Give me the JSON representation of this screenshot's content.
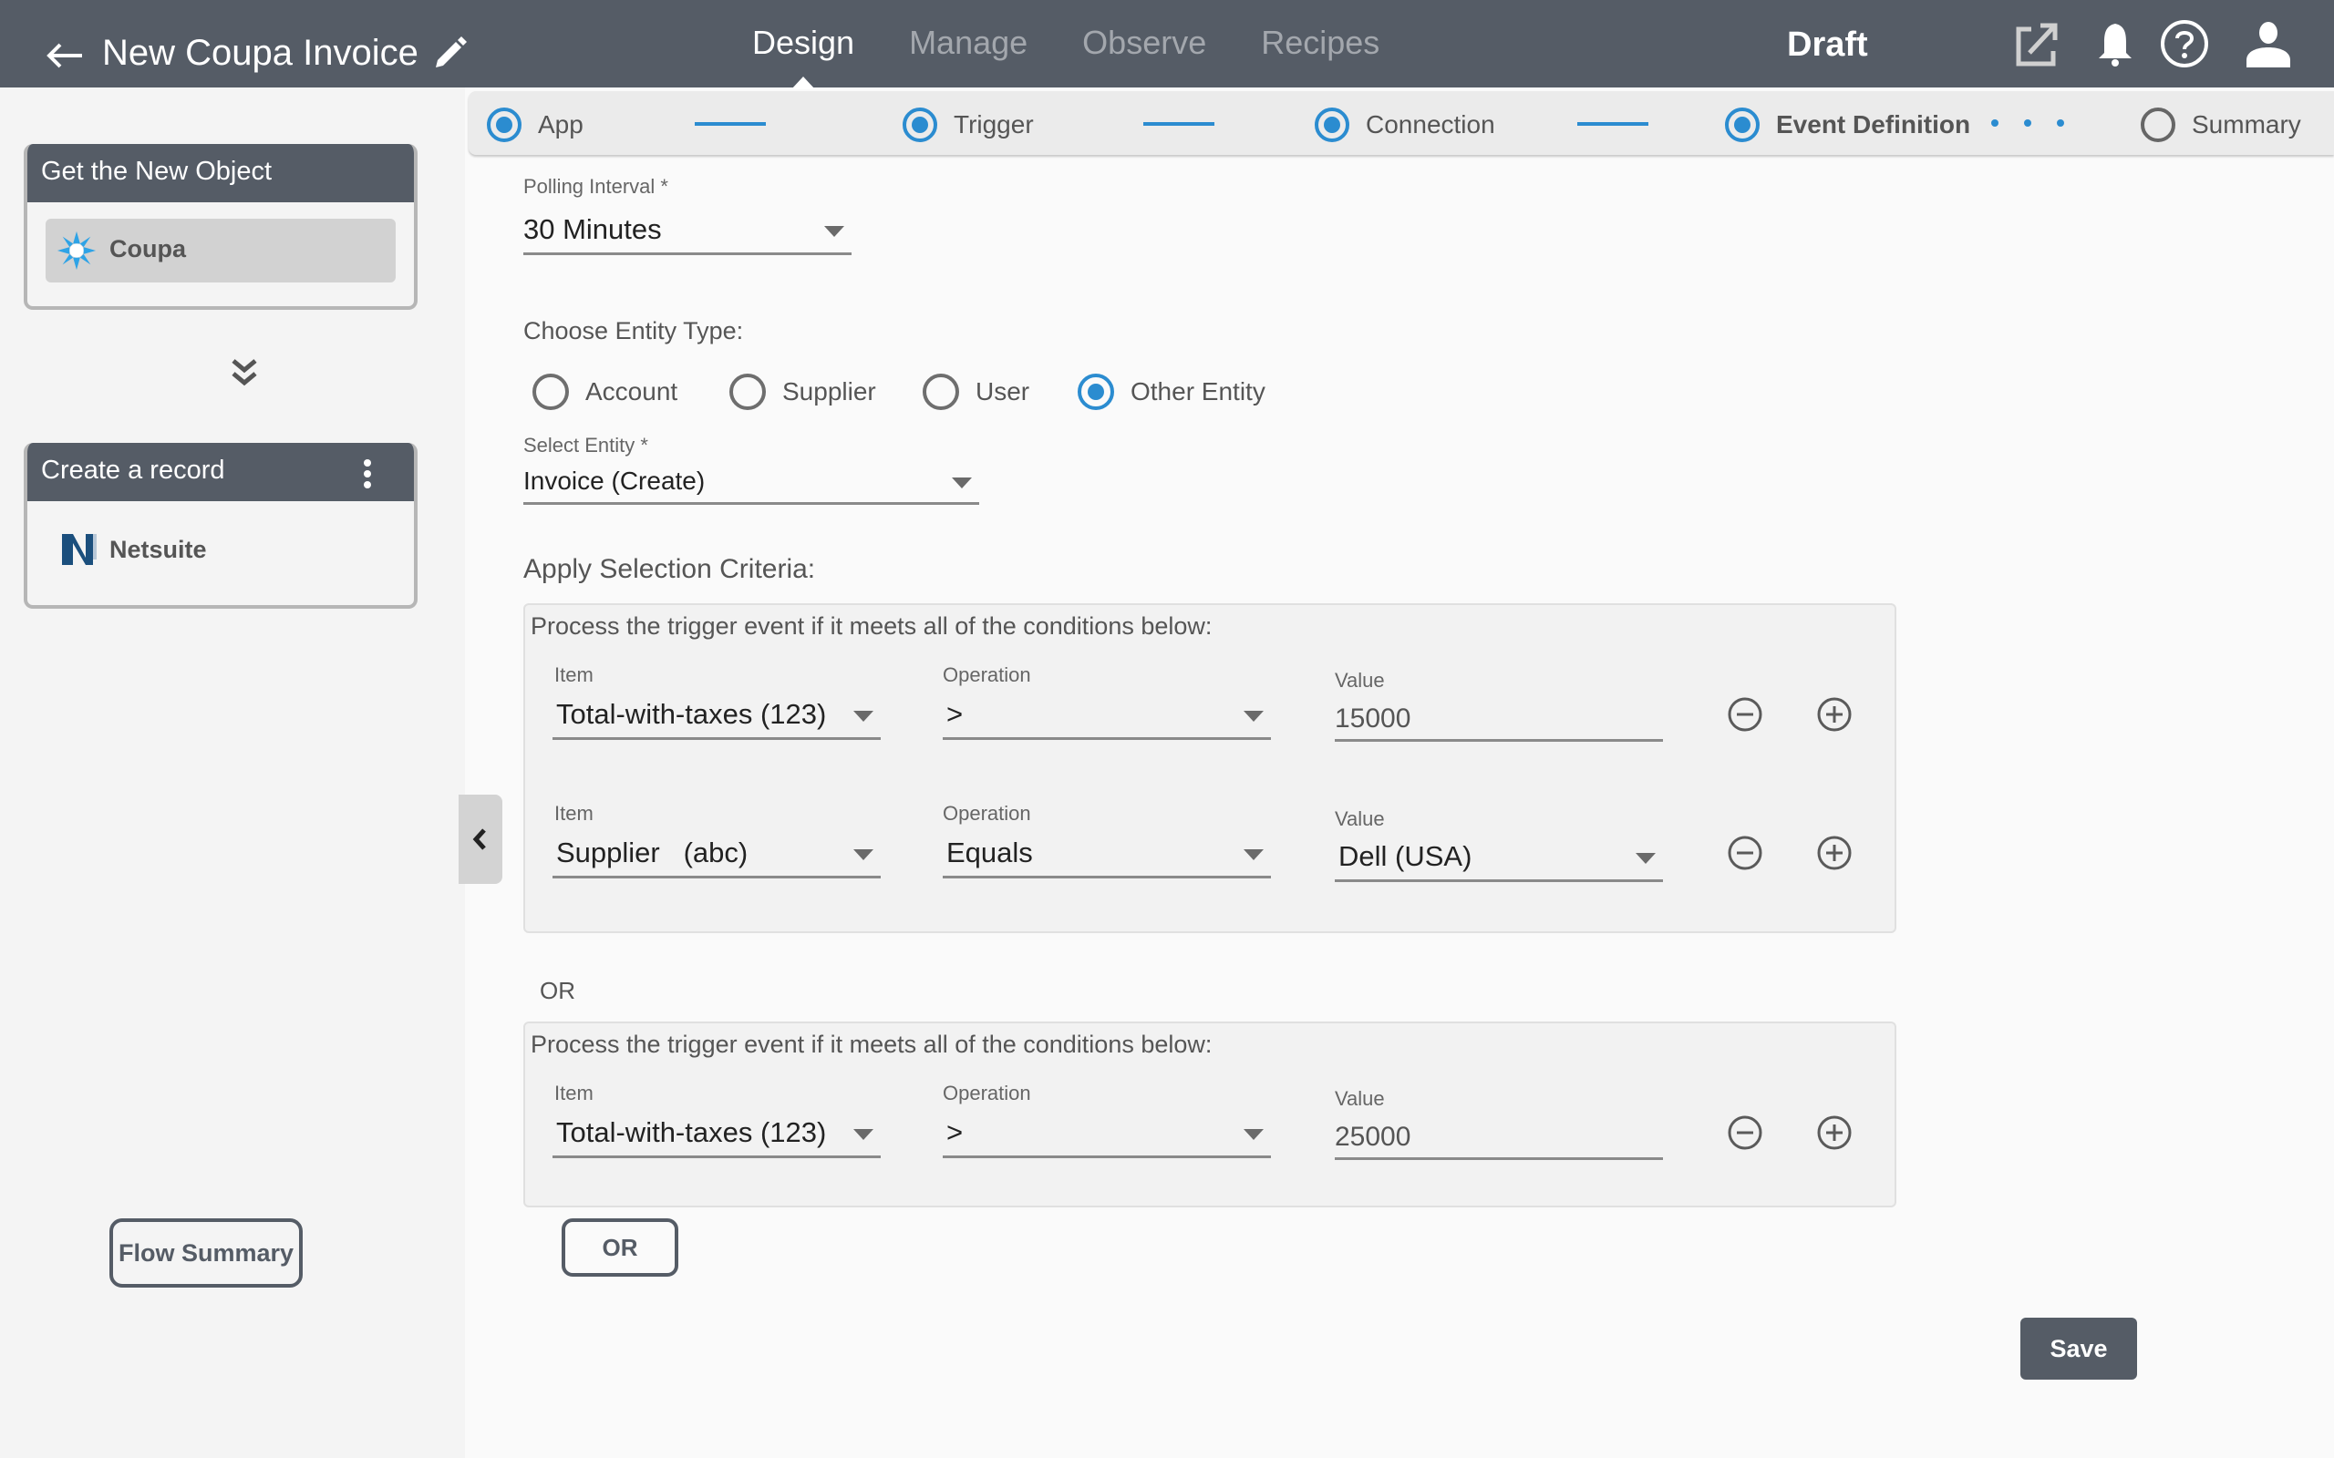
{
  "header": {
    "back_icon": "arrow-left-icon",
    "title": "New Coupa Invoice",
    "edit_icon": "pencil-icon",
    "tabs": [
      {
        "label": "Design",
        "active": true
      },
      {
        "label": "Manage",
        "active": false
      },
      {
        "label": "Observe",
        "active": false
      },
      {
        "label": "Recipes",
        "active": false
      }
    ],
    "status": "Draft",
    "icons": [
      "external-link-icon",
      "bell-icon",
      "help-icon",
      "user-icon"
    ]
  },
  "sidebar": {
    "cards": [
      {
        "title": "Get the New Object",
        "connector": "Coupa",
        "connector_icon": "coupa-logo-icon"
      },
      {
        "title": "Create a record",
        "connector": "Netsuite",
        "connector_icon": "netsuite-logo-icon",
        "menu_icon": "more-vertical-icon"
      }
    ],
    "separator_icon": "double-chevron-down-icon",
    "flow_summary_label": "Flow Summary",
    "collapse_icon": "chevron-left-icon"
  },
  "stepper": {
    "steps": [
      {
        "label": "App",
        "state": "done"
      },
      {
        "label": "Trigger",
        "state": "done"
      },
      {
        "label": "Connection",
        "state": "done"
      },
      {
        "label": "Event Definition",
        "state": "current"
      },
      {
        "label": "Summary",
        "state": "pending"
      }
    ]
  },
  "form": {
    "polling_interval": {
      "label": "Polling Interval *",
      "value": "30 Minutes"
    },
    "entity_type": {
      "label": "Choose Entity Type:",
      "options": [
        "Account",
        "Supplier",
        "User",
        "Other Entity"
      ],
      "selected": "Other Entity"
    },
    "select_entity": {
      "label": "Select Entity *",
      "value": "Invoice (Create)"
    },
    "criteria_label": "Apply Selection Criteria:",
    "groups": [
      {
        "title": "Process the trigger event if it meets all of the conditions below:",
        "conditions": [
          {
            "item_label": "Item",
            "item": "Total-with-taxes (123)",
            "op_label": "Operation",
            "operation": ">",
            "value_label": "Value",
            "value": "15000",
            "value_type": "text"
          },
          {
            "item_label": "Item",
            "item": "Supplier   (abc)",
            "op_label": "Operation",
            "operation": "Equals",
            "value_label": "Value",
            "value": "Dell (USA)",
            "value_type": "select"
          }
        ]
      },
      {
        "title": "Process the trigger event if it meets all of the conditions below:",
        "conditions": [
          {
            "item_label": "Item",
            "item": "Total-with-taxes (123)",
            "op_label": "Operation",
            "operation": ">",
            "value_label": "Value",
            "value": "25000",
            "value_type": "text"
          }
        ]
      }
    ],
    "or_separator": "OR",
    "or_button_label": "OR",
    "save_label": "Save"
  },
  "colors": {
    "header_bg": "#555c66",
    "accent": "#2b8cd0",
    "sidebar_bg": "#f4f4f4"
  }
}
